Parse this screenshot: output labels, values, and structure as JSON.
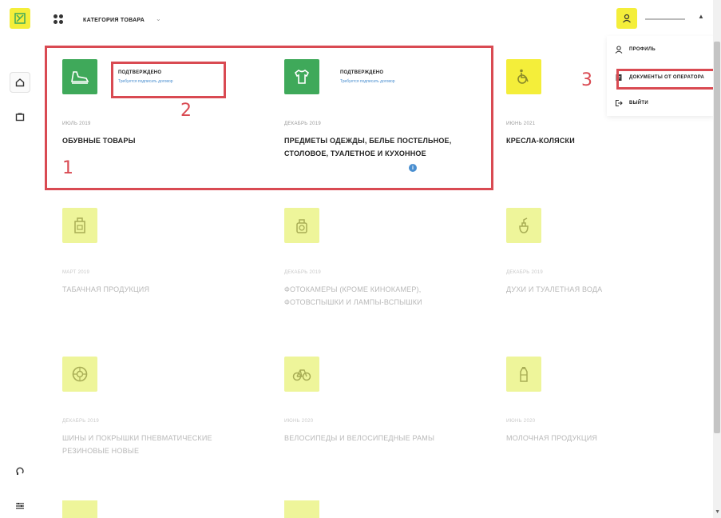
{
  "topbar": {
    "category_label": "КАТЕГОРИЯ ТОВАРА",
    "user_name": ""
  },
  "user_menu": {
    "items": [
      {
        "label": "ПРОФИЛЬ",
        "icon": "user-icon"
      },
      {
        "label": "ДОКУМЕНТЫ ОТ ОПЕРАТОРА",
        "icon": "document-icon"
      },
      {
        "label": "ВЫЙТИ",
        "icon": "logout-icon"
      }
    ]
  },
  "cards": [
    {
      "date": "ИЮЛЬ 2019",
      "name": "ОБУВНЫЕ ТОВАРЫ",
      "status": "ПОДТВЕРЖДЕНО",
      "status_sub": "Требуется подписать договор",
      "icon": "shoes-icon",
      "active": true
    },
    {
      "date": "ДЕКАБРЬ 2019",
      "name": "ПРЕДМЕТЫ ОДЕЖДЫ, БЕЛЬЕ ПОСТЕЛЬНОЕ, СТОЛОВОЕ, ТУАЛЕТНОЕ И КУХОННОЕ",
      "status": "ПОДТВЕРЖДЕНО",
      "status_sub": "Требуется подписать договор",
      "icon": "clothing-icon",
      "active": true
    },
    {
      "date": "ИЮНЬ 2021",
      "name": "КРЕСЛА-КОЛЯСКИ",
      "icon": "wheelchair-icon",
      "active": true
    },
    {
      "date": "МАРТ 2019",
      "name": "ТАБАЧНАЯ ПРОДУКЦИЯ",
      "icon": "tobacco-icon",
      "active": false
    },
    {
      "date": "ДЕКАБРЬ 2019",
      "name": "ФОТОКАМЕРЫ (КРОМЕ КИНОКАМЕР), ФОТОВСПЫШКИ И ЛАМПЫ-ВСПЫШКИ",
      "icon": "camera-icon",
      "active": false
    },
    {
      "date": "ДЕКАБРЬ 2019",
      "name": "ДУХИ И ТУАЛЕТНАЯ ВОДА",
      "icon": "perfume-icon",
      "active": false
    },
    {
      "date": "ДЕКАБРЬ 2019",
      "name": "ШИНЫ И ПОКРЫШКИ ПНЕВМАТИЧЕСКИЕ РЕЗИНОВЫЕ НОВЫЕ",
      "icon": "tire-icon",
      "active": false
    },
    {
      "date": "ИЮНЬ 2020",
      "name": "ВЕЛОСИПЕДЫ И ВЕЛОСИПЕДНЫЕ РАМЫ",
      "icon": "bicycle-icon",
      "active": false
    },
    {
      "date": "ИЮНЬ 2020",
      "name": "МОЛОЧНАЯ ПРОДУКЦИЯ",
      "icon": "milk-icon",
      "active": false
    }
  ],
  "annotations": [
    "1",
    "2",
    "3"
  ],
  "colors": {
    "brand_yellow": "#f4ee3a",
    "confirmed_green": "#3fa95a",
    "annotation_red": "#d94a52",
    "link_blue": "#4a8fd0"
  }
}
